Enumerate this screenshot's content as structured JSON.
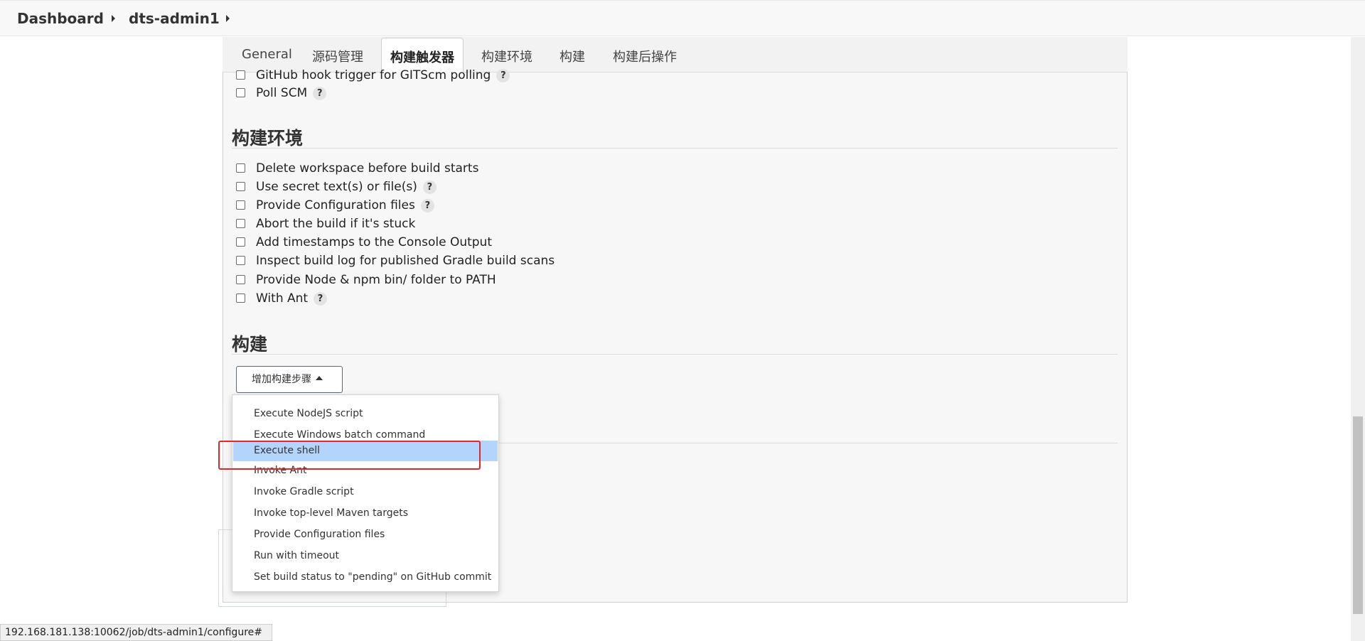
{
  "breadcrumb": {
    "items": [
      "Dashboard",
      "dts-admin1"
    ]
  },
  "tabs": [
    "General",
    "源码管理",
    "构建触发器",
    "构建环境",
    "构建",
    "构建后操作"
  ],
  "active_tab": "构建触发器",
  "triggers": [
    {
      "label": "GitHub hook trigger for GITScm polling",
      "help": "?"
    },
    {
      "label": "Poll SCM",
      "help": "?"
    }
  ],
  "build_env": {
    "title": "构建环境",
    "options": [
      {
        "label": "Delete workspace before build starts",
        "help": ""
      },
      {
        "label": "Use secret text(s) or file(s)",
        "help": "?"
      },
      {
        "label": "Provide Configuration files",
        "help": "?"
      },
      {
        "label": "Abort the build if it's stuck",
        "help": ""
      },
      {
        "label": "Add timestamps to the Console Output",
        "help": ""
      },
      {
        "label": "Inspect build log for published Gradle build scans",
        "help": ""
      },
      {
        "label": "Provide Node & npm bin/ folder to PATH",
        "help": ""
      },
      {
        "label": "With Ant",
        "help": "?"
      }
    ]
  },
  "build": {
    "title": "构建",
    "add_step_label": "增加构建步骤",
    "menu_items": [
      "Execute NodeJS script",
      "Execute Windows batch command",
      "Execute shell",
      "Invoke Ant",
      "Invoke Gradle script",
      "Invoke top-level Maven targets",
      "Provide Configuration files",
      "Run with timeout",
      "Set build status to \"pending\" on GitHub commit"
    ],
    "highlighted_item": "Execute shell"
  },
  "status_bar": {
    "url": "192.168.181.138:10062/job/dts-admin1/configure#"
  },
  "colors": {
    "highlight": "#b3d4fc",
    "annotation_box": "#e0262e"
  }
}
